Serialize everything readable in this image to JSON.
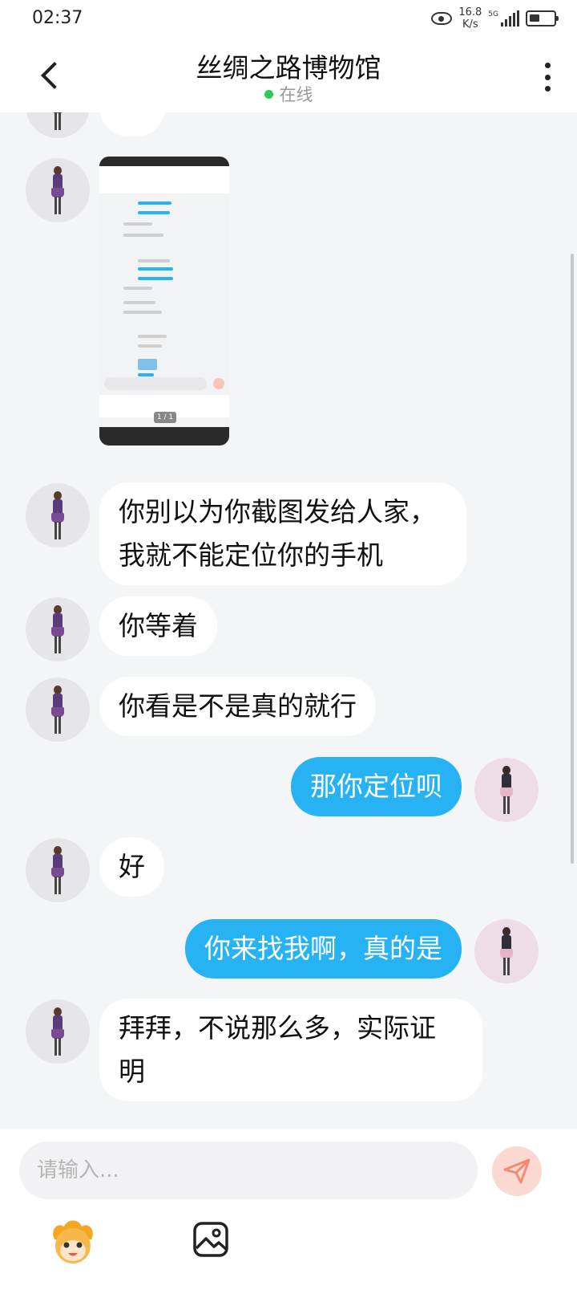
{
  "status_bar": {
    "time": "02:37",
    "net_speed_value": "16.8",
    "net_speed_unit": "K/s",
    "network": "5G"
  },
  "header": {
    "title": "丝绸之路博物馆",
    "status": "在线"
  },
  "messages": [
    {
      "side": "left",
      "type": "image",
      "pager": "1 / 1"
    },
    {
      "side": "left",
      "type": "text",
      "line1": "你别以为你截图发给人家，",
      "line2": "我就不能定位你的手机"
    },
    {
      "side": "left",
      "type": "text",
      "text": "你等着"
    },
    {
      "side": "left",
      "type": "text",
      "text": "你看是不是真的就行"
    },
    {
      "side": "right",
      "type": "text",
      "text": "那你定位呗"
    },
    {
      "side": "left",
      "type": "text",
      "text": "好"
    },
    {
      "side": "right",
      "type": "text",
      "text": "你来找我啊，真的是"
    },
    {
      "side": "left",
      "type": "text",
      "line1": "拜拜，不说那么多，实际证",
      "line2": "明"
    }
  ],
  "composer": {
    "placeholder": "请输入..."
  },
  "colors": {
    "accent": "#27b3f3",
    "online": "#34c759",
    "send": "#fad9d2"
  },
  "icons": [
    "back-arrow-icon",
    "more-icon",
    "send-icon",
    "emoji-icon",
    "image-icon",
    "eye-icon",
    "battery-icon"
  ]
}
